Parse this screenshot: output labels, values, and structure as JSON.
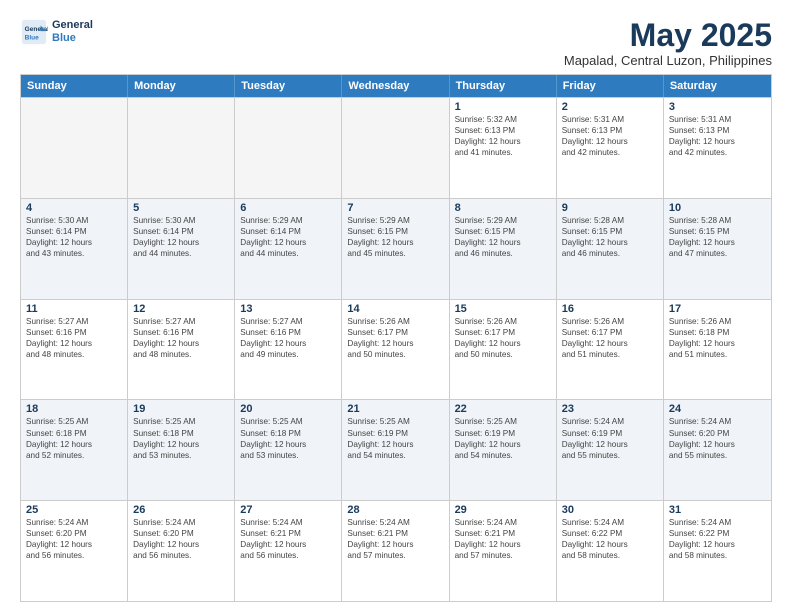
{
  "header": {
    "logo_line1": "General",
    "logo_line2": "Blue",
    "month_title": "May 2025",
    "subtitle": "Mapalad, Central Luzon, Philippines"
  },
  "weekdays": [
    "Sunday",
    "Monday",
    "Tuesday",
    "Wednesday",
    "Thursday",
    "Friday",
    "Saturday"
  ],
  "rows": [
    [
      {
        "day": "",
        "empty": true
      },
      {
        "day": "",
        "empty": true
      },
      {
        "day": "",
        "empty": true
      },
      {
        "day": "",
        "empty": true
      },
      {
        "day": "1",
        "info": "Sunrise: 5:32 AM\nSunset: 6:13 PM\nDaylight: 12 hours\nand 41 minutes."
      },
      {
        "day": "2",
        "info": "Sunrise: 5:31 AM\nSunset: 6:13 PM\nDaylight: 12 hours\nand 42 minutes."
      },
      {
        "day": "3",
        "info": "Sunrise: 5:31 AM\nSunset: 6:13 PM\nDaylight: 12 hours\nand 42 minutes."
      }
    ],
    [
      {
        "day": "4",
        "info": "Sunrise: 5:30 AM\nSunset: 6:14 PM\nDaylight: 12 hours\nand 43 minutes."
      },
      {
        "day": "5",
        "info": "Sunrise: 5:30 AM\nSunset: 6:14 PM\nDaylight: 12 hours\nand 44 minutes."
      },
      {
        "day": "6",
        "info": "Sunrise: 5:29 AM\nSunset: 6:14 PM\nDaylight: 12 hours\nand 44 minutes."
      },
      {
        "day": "7",
        "info": "Sunrise: 5:29 AM\nSunset: 6:15 PM\nDaylight: 12 hours\nand 45 minutes."
      },
      {
        "day": "8",
        "info": "Sunrise: 5:29 AM\nSunset: 6:15 PM\nDaylight: 12 hours\nand 46 minutes."
      },
      {
        "day": "9",
        "info": "Sunrise: 5:28 AM\nSunset: 6:15 PM\nDaylight: 12 hours\nand 46 minutes."
      },
      {
        "day": "10",
        "info": "Sunrise: 5:28 AM\nSunset: 6:15 PM\nDaylight: 12 hours\nand 47 minutes."
      }
    ],
    [
      {
        "day": "11",
        "info": "Sunrise: 5:27 AM\nSunset: 6:16 PM\nDaylight: 12 hours\nand 48 minutes."
      },
      {
        "day": "12",
        "info": "Sunrise: 5:27 AM\nSunset: 6:16 PM\nDaylight: 12 hours\nand 48 minutes."
      },
      {
        "day": "13",
        "info": "Sunrise: 5:27 AM\nSunset: 6:16 PM\nDaylight: 12 hours\nand 49 minutes."
      },
      {
        "day": "14",
        "info": "Sunrise: 5:26 AM\nSunset: 6:17 PM\nDaylight: 12 hours\nand 50 minutes."
      },
      {
        "day": "15",
        "info": "Sunrise: 5:26 AM\nSunset: 6:17 PM\nDaylight: 12 hours\nand 50 minutes."
      },
      {
        "day": "16",
        "info": "Sunrise: 5:26 AM\nSunset: 6:17 PM\nDaylight: 12 hours\nand 51 minutes."
      },
      {
        "day": "17",
        "info": "Sunrise: 5:26 AM\nSunset: 6:18 PM\nDaylight: 12 hours\nand 51 minutes."
      }
    ],
    [
      {
        "day": "18",
        "info": "Sunrise: 5:25 AM\nSunset: 6:18 PM\nDaylight: 12 hours\nand 52 minutes."
      },
      {
        "day": "19",
        "info": "Sunrise: 5:25 AM\nSunset: 6:18 PM\nDaylight: 12 hours\nand 53 minutes."
      },
      {
        "day": "20",
        "info": "Sunrise: 5:25 AM\nSunset: 6:18 PM\nDaylight: 12 hours\nand 53 minutes."
      },
      {
        "day": "21",
        "info": "Sunrise: 5:25 AM\nSunset: 6:19 PM\nDaylight: 12 hours\nand 54 minutes."
      },
      {
        "day": "22",
        "info": "Sunrise: 5:25 AM\nSunset: 6:19 PM\nDaylight: 12 hours\nand 54 minutes."
      },
      {
        "day": "23",
        "info": "Sunrise: 5:24 AM\nSunset: 6:19 PM\nDaylight: 12 hours\nand 55 minutes."
      },
      {
        "day": "24",
        "info": "Sunrise: 5:24 AM\nSunset: 6:20 PM\nDaylight: 12 hours\nand 55 minutes."
      }
    ],
    [
      {
        "day": "25",
        "info": "Sunrise: 5:24 AM\nSunset: 6:20 PM\nDaylight: 12 hours\nand 56 minutes."
      },
      {
        "day": "26",
        "info": "Sunrise: 5:24 AM\nSunset: 6:20 PM\nDaylight: 12 hours\nand 56 minutes."
      },
      {
        "day": "27",
        "info": "Sunrise: 5:24 AM\nSunset: 6:21 PM\nDaylight: 12 hours\nand 56 minutes."
      },
      {
        "day": "28",
        "info": "Sunrise: 5:24 AM\nSunset: 6:21 PM\nDaylight: 12 hours\nand 57 minutes."
      },
      {
        "day": "29",
        "info": "Sunrise: 5:24 AM\nSunset: 6:21 PM\nDaylight: 12 hours\nand 57 minutes."
      },
      {
        "day": "30",
        "info": "Sunrise: 5:24 AM\nSunset: 6:22 PM\nDaylight: 12 hours\nand 58 minutes."
      },
      {
        "day": "31",
        "info": "Sunrise: 5:24 AM\nSunset: 6:22 PM\nDaylight: 12 hours\nand 58 minutes."
      }
    ]
  ]
}
